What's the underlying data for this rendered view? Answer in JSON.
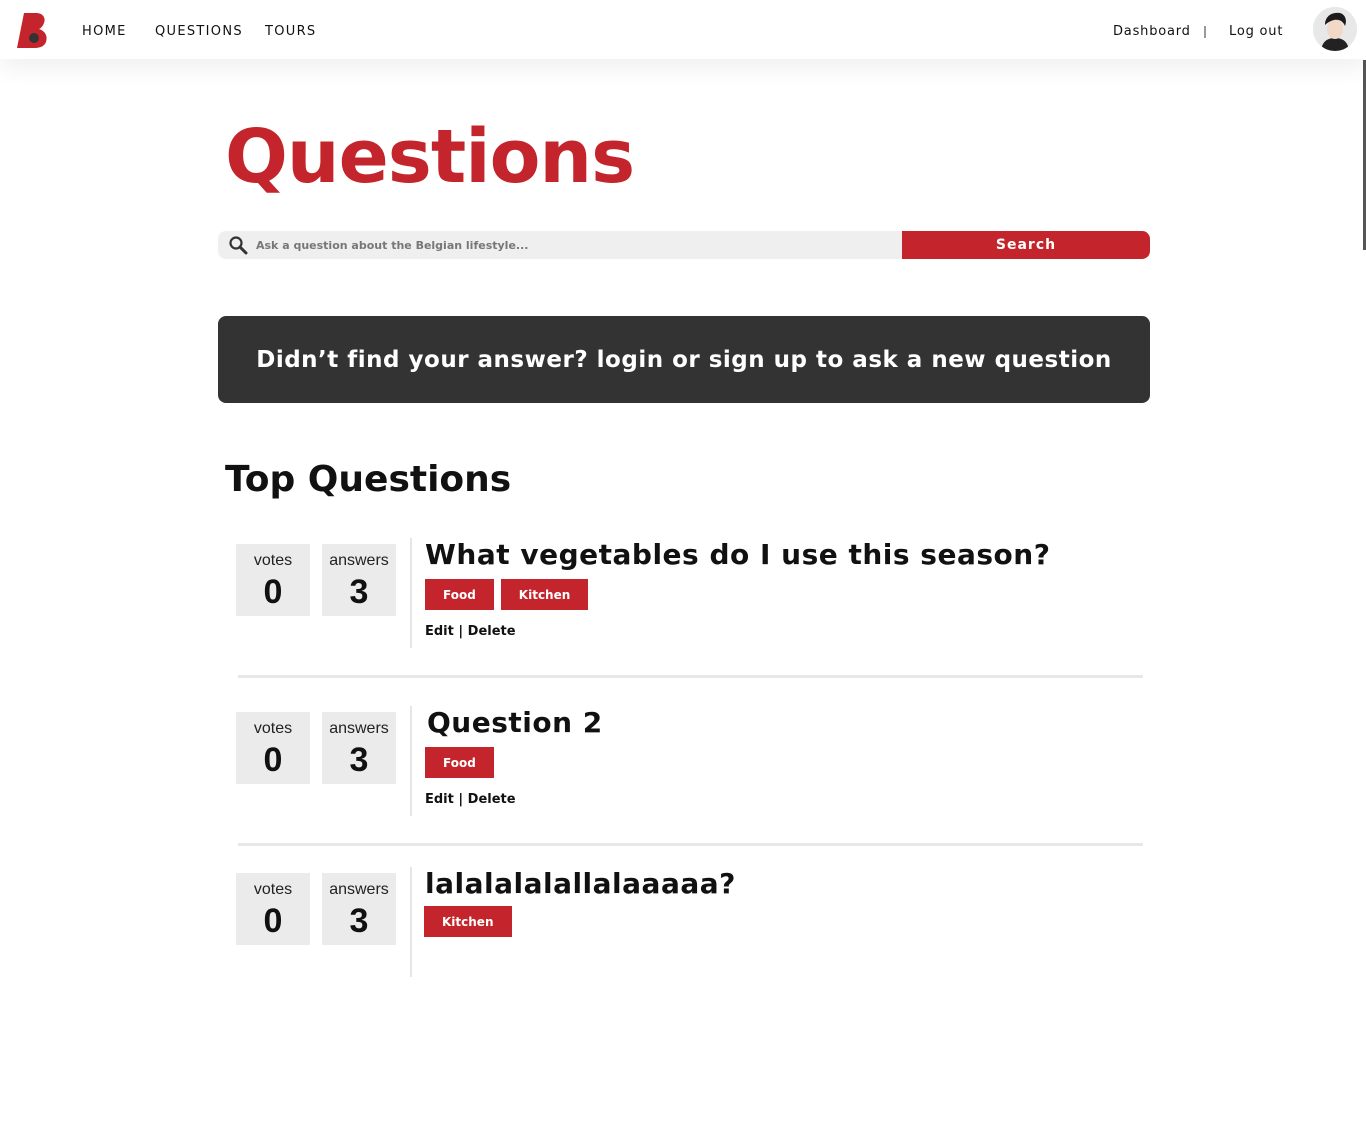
{
  "nav": {
    "links": [
      "HOME",
      "QUESTIONS",
      "TOURS"
    ],
    "dashboard": "Dashboard",
    "logout": "Log out"
  },
  "colors": {
    "accent": "#c4242b",
    "banner_bg": "#333333",
    "stat_bg": "#ebebeb"
  },
  "page": {
    "title": "Questions",
    "search": {
      "placeholder": "Ask a question about the Belgian lifestyle...",
      "button": "Search"
    },
    "banner": "Didn’t find your answer? login or sign up to ask a new question",
    "section_title": "Top Questions"
  },
  "questions": [
    {
      "votes_label": "votes",
      "votes": "0",
      "answers_label": "answers",
      "answers": "3",
      "title": "What vegetables do I use this season?",
      "tags": [
        "Food",
        "Kitchen"
      ],
      "edit": "Edit",
      "sep": "|",
      "delete": "Delete"
    },
    {
      "votes_label": "votes",
      "votes": "0",
      "answers_label": "answers",
      "answers": "3",
      "title": "Question 2",
      "tags": [
        "Food"
      ],
      "edit": "Edit",
      "sep": "|",
      "delete": "Delete"
    },
    {
      "votes_label": "votes",
      "votes": "0",
      "answers_label": "answers",
      "answers": "3",
      "title": "lalalalalallalaaaaa?",
      "tags": [
        "Kitchen"
      ]
    }
  ]
}
